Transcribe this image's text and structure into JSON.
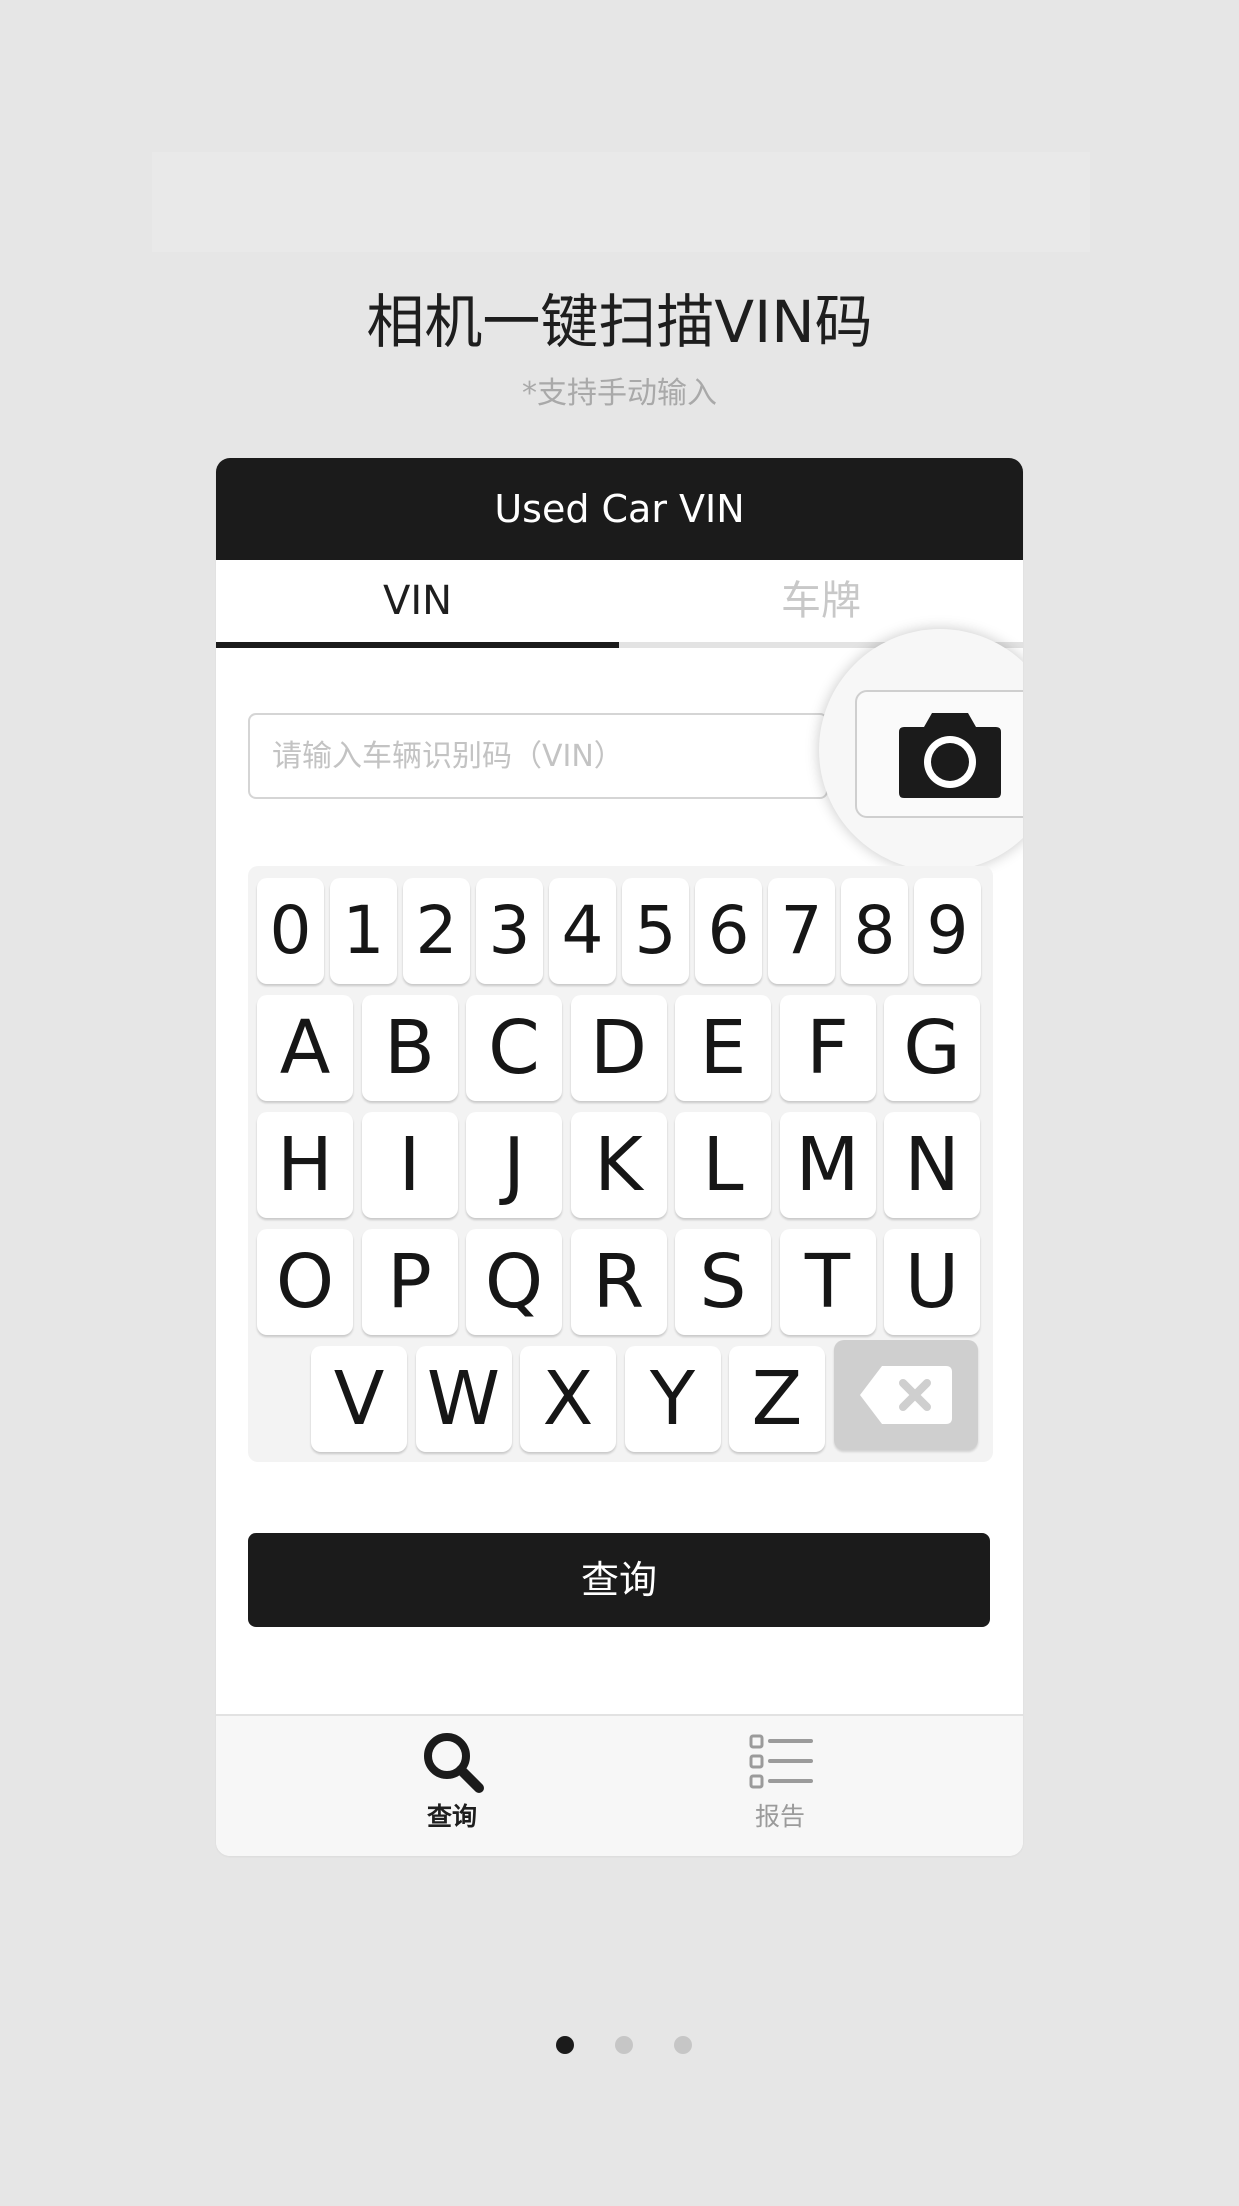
{
  "promo": {
    "headline": "相机一键扫描VIN码",
    "subheadline": "*支持手动输入"
  },
  "app": {
    "title": "Used Car VIN",
    "tabs": [
      {
        "label": "VIN",
        "active": true
      },
      {
        "label": "车牌",
        "active": false
      }
    ],
    "vin_input": {
      "placeholder": "请输入车辆识别码（VIN）",
      "value": ""
    },
    "camera_icon": "camera-icon",
    "keyboard": {
      "rows": [
        [
          "0",
          "1",
          "2",
          "3",
          "4",
          "5",
          "6",
          "7",
          "8",
          "9"
        ],
        [
          "A",
          "B",
          "C",
          "D",
          "E",
          "F",
          "G"
        ],
        [
          "H",
          "I",
          "J",
          "K",
          "L",
          "M",
          "N"
        ],
        [
          "O",
          "P",
          "Q",
          "R",
          "S",
          "T",
          "U"
        ],
        [
          "V",
          "W",
          "X",
          "Y",
          "Z"
        ]
      ],
      "backspace_icon": "backspace-icon"
    },
    "query_button": "查询",
    "bottom_nav": [
      {
        "label": "查询",
        "icon": "search-icon",
        "active": true
      },
      {
        "label": "报告",
        "icon": "list-icon",
        "active": false
      }
    ]
  },
  "pagination": {
    "total": 3,
    "active": 1
  },
  "colors": {
    "background": "#e6e6e6",
    "accent": "#1b1b1b",
    "inactive": "#c6c6c6"
  }
}
